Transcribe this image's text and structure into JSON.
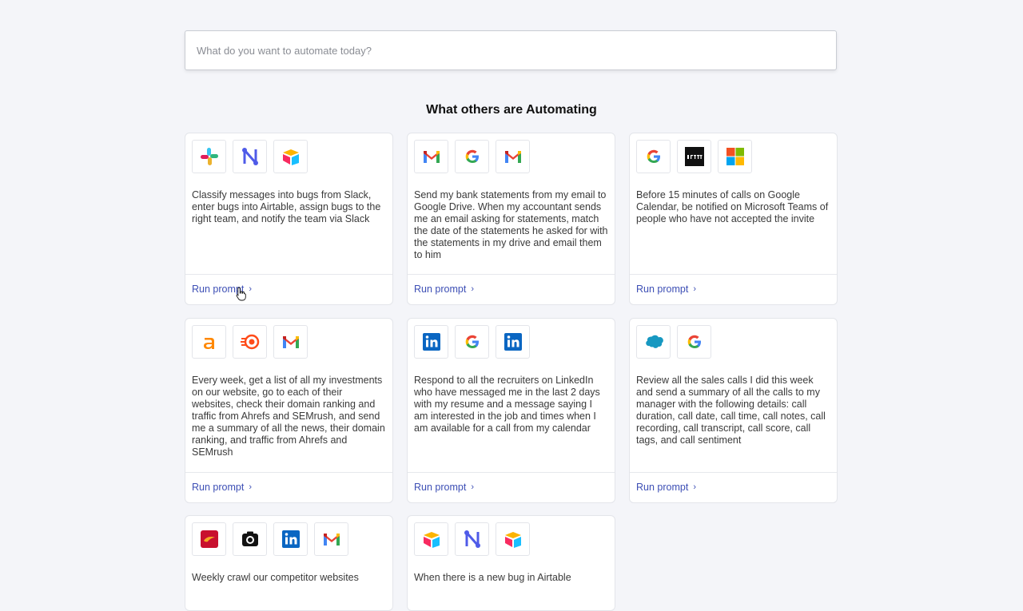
{
  "search": {
    "placeholder": "What do you want to automate today?",
    "value": ""
  },
  "section": {
    "title": "What others are Automating"
  },
  "run_label": "Run prompt",
  "chevron": "›",
  "cards": [
    {
      "icons": [
        "slack-icon",
        "n8n-icon",
        "airtable-icon"
      ],
      "text": "Classify messages into bugs from Slack, enter bugs into Airtable, assign bugs to the right team, and notify the team via Slack"
    },
    {
      "icons": [
        "gmail-icon",
        "google-icon",
        "gmail-icon"
      ],
      "text": "Send my bank statements from my email to Google Drive. When my accountant sends me an email asking for statements, match the date of the statements he asked for with the statements in my drive and email them to him"
    },
    {
      "icons": [
        "google-icon",
        "ifttt-icon",
        "microsoft-icon"
      ],
      "text": "Before 15 minutes of calls on Google Calendar, be notified on Microsoft Teams of people who have not accepted the invite"
    },
    {
      "icons": [
        "ahrefs-icon",
        "semrush-icon",
        "gmail-icon"
      ],
      "text": "Every week, get a list of all my investments on our website, go to each of their websites, check their domain ranking and traffic from Ahrefs and SEMrush, and send me a summary of all the news, their domain ranking, and traffic from Ahrefs and SEMrush"
    },
    {
      "icons": [
        "linkedin-icon",
        "google-icon",
        "linkedin-icon"
      ],
      "text": "Respond to all the recruiters on LinkedIn who have messaged me in the last 2 days with my resume and a message saying I am interested in the job and times when I am available for a call from my calendar"
    },
    {
      "icons": [
        "salesforce-icon",
        "google-icon"
      ],
      "text": "Review all the sales calls I did this week and send a summary of all the calls to my manager with the following details: call duration, call date, call time, call notes, call recording, call transcript, call score, call tags, and call sentiment"
    },
    {
      "icons": [
        "reddit-like-icon",
        "camera-icon",
        "linkedin-icon",
        "gmail-icon"
      ],
      "text": "Weekly crawl our competitor websites"
    },
    {
      "icons": [
        "airtable-icon",
        "n8n-icon",
        "airtable-icon"
      ],
      "text": "When there is a new bug in Airtable"
    }
  ],
  "colors": {
    "accent": "#3d4fb5",
    "background": "#f4f5f9"
  }
}
